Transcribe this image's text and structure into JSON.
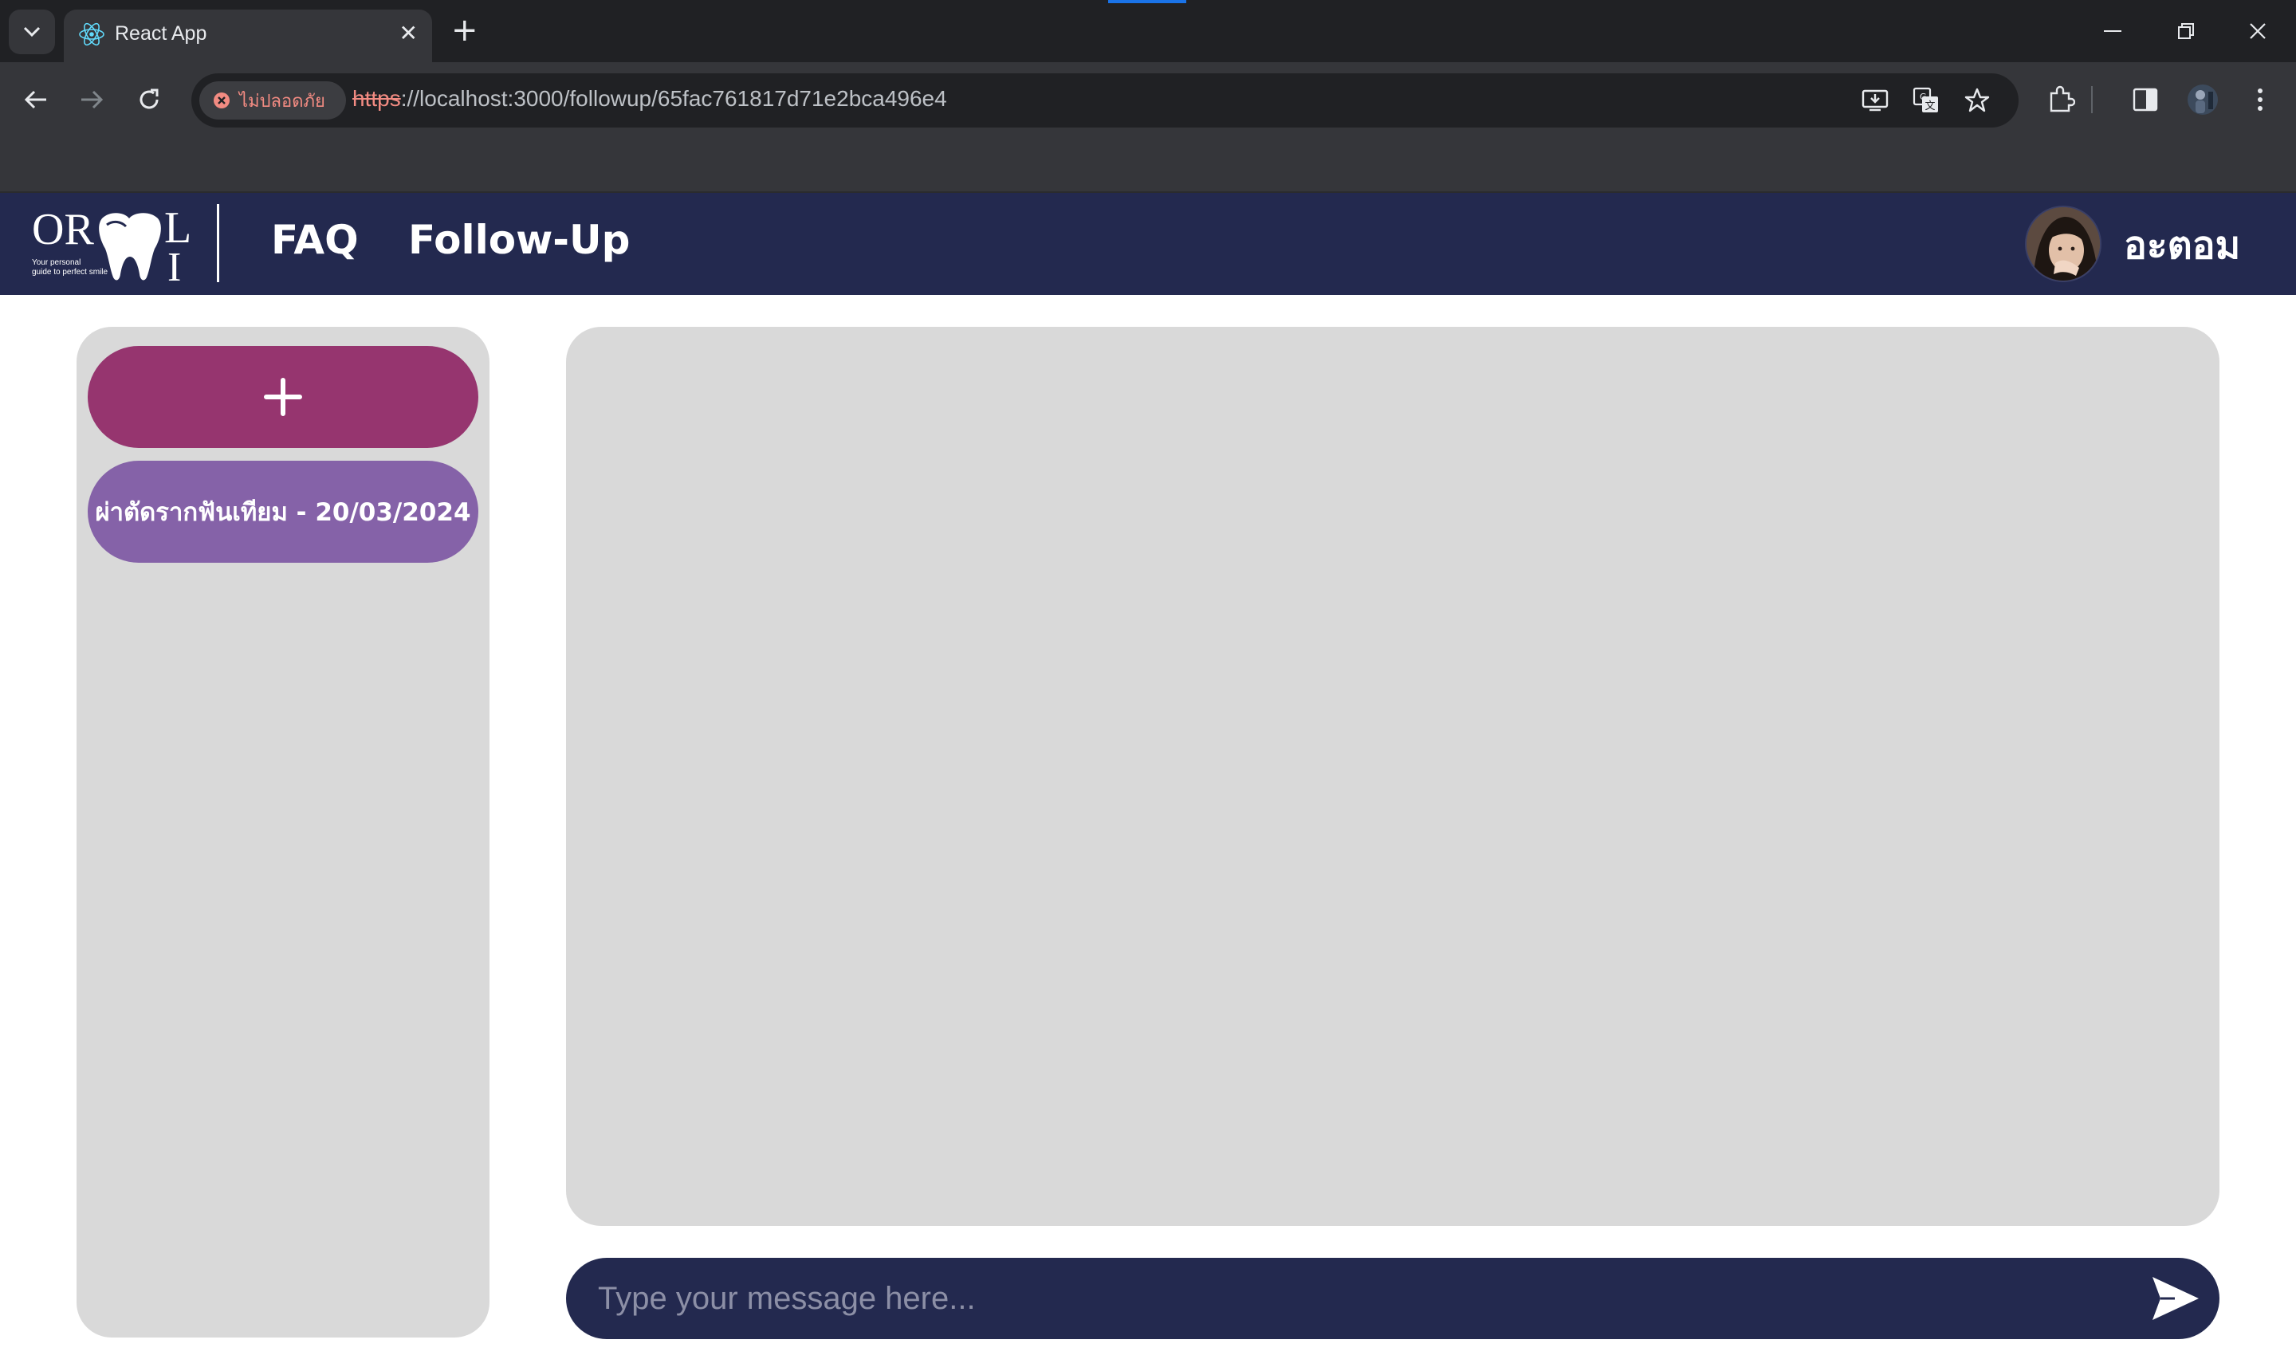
{
  "browser": {
    "tab": {
      "title": "React App",
      "favicon": "react-icon"
    },
    "address": {
      "security_label": "ไม่ปลอดภัย",
      "url_scheme": "https",
      "url_rest": "://localhost:3000/followup/65fac761817d71e2bca496e4"
    }
  },
  "header": {
    "logo": {
      "text_left": "OR",
      "text_right_top": "L",
      "text_right_bottom": "I",
      "tagline_line1": "Your personal",
      "tagline_line2": "guide to perfect smile"
    },
    "nav": [
      {
        "label": "FAQ"
      },
      {
        "label": "Follow-Up"
      }
    ],
    "user": {
      "name": "อะตอม"
    }
  },
  "sidebar": {
    "add_label": "+",
    "items": [
      {
        "label": "ผ่าตัดรากฟันเทียม - 20/03/2024"
      }
    ]
  },
  "composer": {
    "placeholder": "Type your message here..."
  },
  "colors": {
    "navy": "#23294f",
    "add_button": "#96356f",
    "item_button": "#8562a8",
    "panel": "#d9d9d9"
  }
}
